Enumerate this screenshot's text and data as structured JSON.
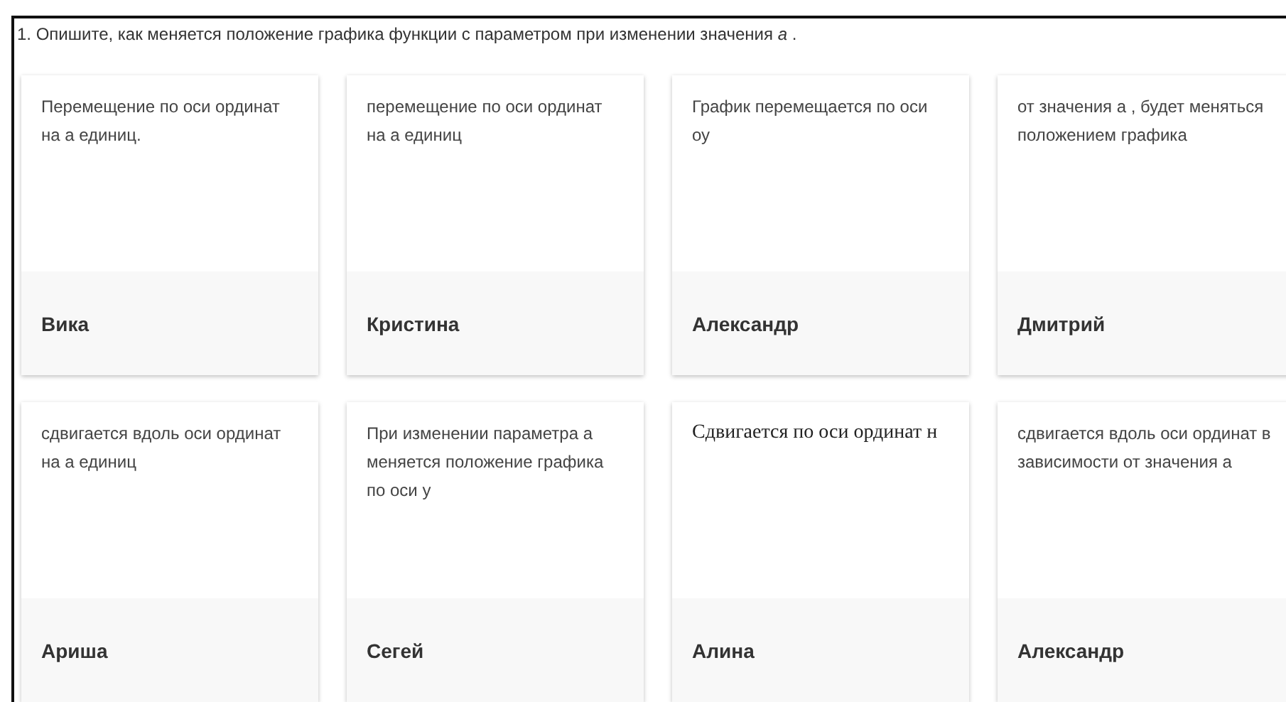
{
  "question": "1. Опишите, как меняется положение графика функции с параметром при изменении значения  *a* .",
  "answers": [
    {
      "kind": "plain",
      "text": "Перемещение по оси ординат на а единиц.",
      "author": "Вика"
    },
    {
      "kind": "plain",
      "text": "перемещение по оси ординат на а единиц",
      "author": "Кристина"
    },
    {
      "kind": "plain",
      "text": "График перемещается по оси оу",
      "author": "Александр"
    },
    {
      "kind": "plain",
      "text": "от значения а , будет меняться положением графика",
      "author": "Дмитрий"
    },
    {
      "kind": "plain",
      "text": "сдвигается вдоль оси ординат на а единиц",
      "author": "Ариша"
    },
    {
      "kind": "plain",
      "text": "При изменении параметра а меняется положение графика по оси у",
      "author": "Сегей"
    },
    {
      "kind": "math",
      "text": "Сдвигается по оси ординат н",
      "author": "Алина"
    },
    {
      "kind": "plain",
      "text": "сдвигается вдоль оси ординат в зависимости от значения а",
      "author": "Александр"
    }
  ]
}
